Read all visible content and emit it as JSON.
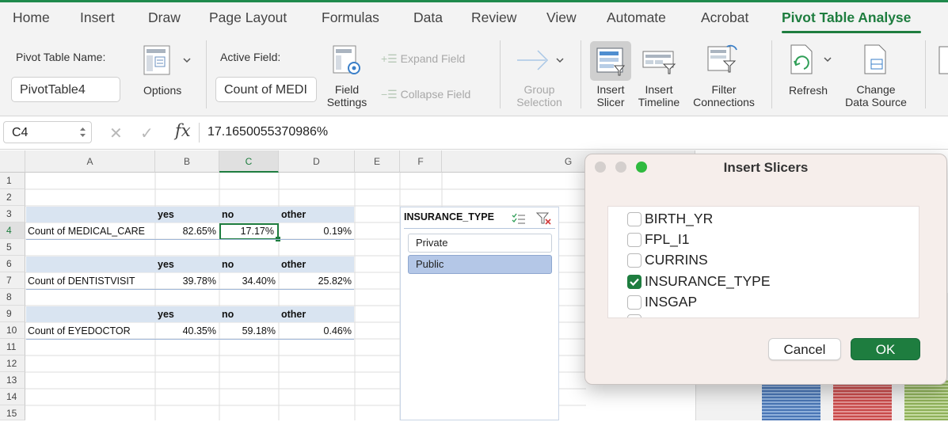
{
  "ribbon_tabs": [
    "Home",
    "Insert",
    "Draw",
    "Page Layout",
    "Formulas",
    "Data",
    "Review",
    "View",
    "Automate",
    "Acrobat",
    "Pivot Table Analyse"
  ],
  "active_tab": "Pivot Table Analyse",
  "ribbon": {
    "pivot_name_label": "Pivot Table Name:",
    "pivot_name_value": "PivotTable4",
    "options_label": "Options",
    "active_field_label": "Active Field:",
    "active_field_value": "Count of MEDI",
    "field_settings_line1": "Field",
    "field_settings_line2": "Settings",
    "expand_field": "Expand Field",
    "collapse_field": "Collapse Field",
    "group_selection_line1": "Group",
    "group_selection_line2": "Selection",
    "insert_slicer_line1": "Insert",
    "insert_slicer_line2": "Slicer",
    "insert_timeline_line1": "Insert",
    "insert_timeline_line2": "Timeline",
    "filter_connections_line1": "Filter",
    "filter_connections_line2": "Connections",
    "refresh": "Refresh",
    "change_source_line1": "Change",
    "change_source_line2": "Data Source"
  },
  "formula_bar": {
    "cell_ref": "C4",
    "fx": "fx",
    "value": "17.1650055370986%"
  },
  "columns": [
    "A",
    "B",
    "C",
    "D",
    "E",
    "F",
    "G"
  ],
  "selected_column": "C",
  "rows": [
    "1",
    "2",
    "3",
    "4",
    "5",
    "6",
    "7",
    "8",
    "9",
    "10",
    "11",
    "12",
    "13",
    "14",
    "15"
  ],
  "selected_row": "4",
  "pivot": {
    "headers": [
      "yes",
      "no",
      "other"
    ],
    "medical_label": "Count of MEDICAL_CARE",
    "medical_values": [
      "82.65%",
      "17.17%",
      "0.19%"
    ],
    "dentist_label": "Count of DENTISTVISIT",
    "dentist_values": [
      "39.78%",
      "34.40%",
      "25.82%"
    ],
    "eye_label": "Count of EYEDOCTOR",
    "eye_values": [
      "40.35%",
      "59.18%",
      "0.46%"
    ]
  },
  "slicer": {
    "title": "INSURANCE_TYPE",
    "items": [
      "Private",
      "Public"
    ],
    "selected": "Public"
  },
  "dialog": {
    "title": "Insert Slicers",
    "fields": [
      "BIRTH_YR",
      "FPL_I1",
      "CURRINS",
      "INSURANCE_TYPE",
      "INSGAP"
    ],
    "checked": [
      false,
      false,
      false,
      true,
      false
    ],
    "cancel": "Cancel",
    "ok": "OK"
  },
  "colors": {
    "accent_green": "#1e7d3f",
    "header_band": "#d9e4f1",
    "slicer_selected": "#b4c7e7",
    "dialog_bg": "#f6eeeb"
  }
}
